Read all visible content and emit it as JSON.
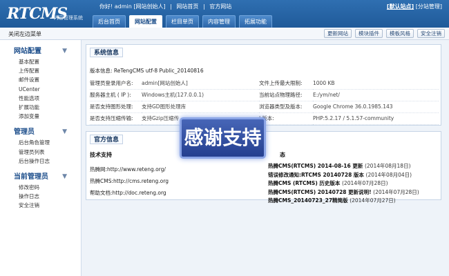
{
  "header": {
    "logo": "RTCMS",
    "logo_sub": "内容管理系统",
    "greeting": "你好! admin [网站创始人]",
    "top_links": [
      "网站首页",
      "官方网站"
    ],
    "right_links": [
      "[默认站点]",
      "[分站管理]"
    ],
    "tabs": [
      {
        "label": "后台首页",
        "active": false
      },
      {
        "label": "网站配置",
        "active": true
      },
      {
        "label": "栏目单页",
        "active": false
      },
      {
        "label": "内容管理",
        "active": false
      },
      {
        "label": "拓展功能",
        "active": false
      }
    ]
  },
  "subbar": {
    "close_sidebar": "关闭左边菜单",
    "buttons": [
      "更新网站",
      "模块插件",
      "模板风格",
      "安全注销"
    ]
  },
  "sidebar": {
    "sections": [
      {
        "title": "网站配置",
        "items": [
          "基本配置",
          "上传配置",
          "邮件设置",
          "UCenter",
          "性能选项",
          "扩展功能",
          "添加变量"
        ]
      },
      {
        "title": "管理员",
        "items": [
          "后台角色管理",
          "管理员列表",
          "后台操作日志"
        ]
      },
      {
        "title": "当前管理员",
        "items": [
          "修改密码",
          "操作日志",
          "安全注销"
        ]
      }
    ]
  },
  "system_info": {
    "title": "系统信息",
    "version_label": "版本信息:",
    "version_value": "ReTengCMS utf-8 Public_20140816",
    "rows": [
      {
        "l1": "管理员登录用户名:",
        "v1": "admin[网站创始人]",
        "l2": "文件上传最大限制:",
        "v2": "1000 KB"
      },
      {
        "l1": "服务器主机 ( IP ):",
        "v1": "Windows主机(127.0.0.1)",
        "l2": "当前站点物理路径:",
        "v2": "E:/ym/net/"
      },
      {
        "l1": "是否支持图形处理:",
        "v1": "支持GD图形处理库",
        "l2": "浏览器类型及版本:",
        "v2": "Google Chrome 36.0.1985.143"
      },
      {
        "l1": "是否支持压缩传输:",
        "v1": "支持Gzip压缩传",
        "l2": "L版本:",
        "v2": "PHP:5.2.17 / 5.1.57-community"
      }
    ]
  },
  "official_info": {
    "title": "官方信息",
    "tech_support": "技术支持",
    "news_header": "态",
    "links": [
      {
        "label": "热腾网:",
        "url": "http://www.reteng.org/"
      },
      {
        "label": "热腾CMS:",
        "url": "http://cms.reteng.org"
      },
      {
        "label": "帮助文档:",
        "url": "http://doc.reteng.org"
      }
    ],
    "news": [
      {
        "title": "热腾CMS(RTCMS) 2014-08-16 更新",
        "date": "(2014年08月18日)"
      },
      {
        "title": "错误修改通知:RTCMS 20140728 版本",
        "date": "(2014年08月04日)"
      },
      {
        "title": "热腾CMS (RTCMS) 历史版本",
        "date": "(2014年07月28日)"
      },
      {
        "title": "热腾CMS(RTCMS) 20140728 更新说明!",
        "date": "(2014年07月28日)"
      },
      {
        "title": "热腾CMS_20140723_27精简版",
        "date": "(2014年07月27日)"
      }
    ]
  },
  "popup": {
    "text": "感谢支持"
  }
}
